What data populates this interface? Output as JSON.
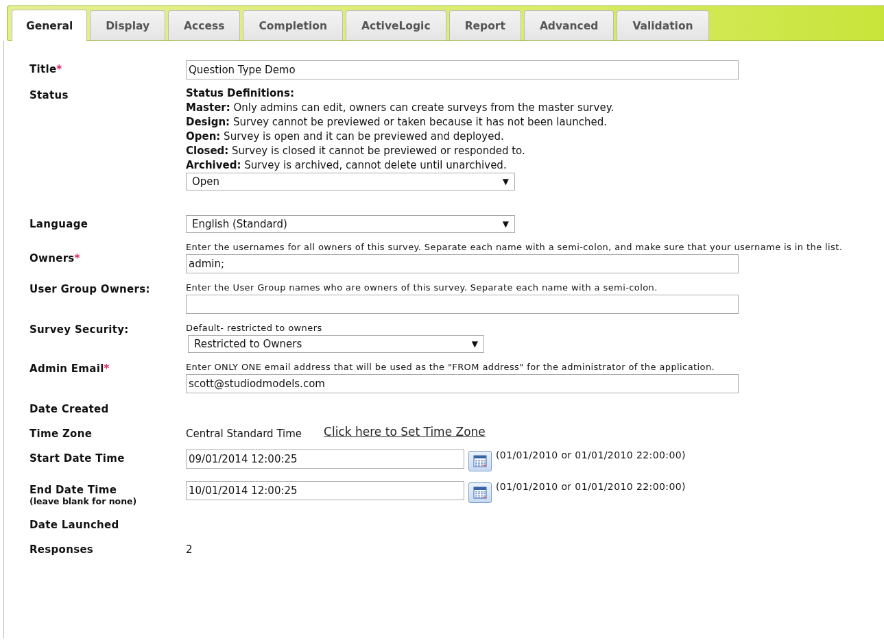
{
  "tabs": [
    {
      "label": "General",
      "selected": true
    },
    {
      "label": "Display",
      "selected": false
    },
    {
      "label": "Access",
      "selected": false
    },
    {
      "label": "Completion",
      "selected": false
    },
    {
      "label": "ActiveLogic",
      "selected": false
    },
    {
      "label": "Report",
      "selected": false
    },
    {
      "label": "Advanced",
      "selected": false
    },
    {
      "label": "Validation",
      "selected": false
    }
  ],
  "fields": [
    {
      "kind": "text",
      "label": "Title",
      "required_mark": "*",
      "value": "Question Type Demo"
    },
    {
      "kind": "status",
      "label": "Status",
      "heading": "Status Definitions:",
      "definitions": [
        "**Master:** Only admins can edit, owners can create surveys from the master survey.",
        "**Design:** Survey cannot be previewed or taken because it has not been launched.",
        "**Open:** Survey is open and it can be previewed and deployed.",
        "**Closed:** Survey is closed it cannot be previewed or responded to.",
        "**Archived:** Survey is archived, cannot delete until unarchived."
      ],
      "value": "Open",
      "arrow": "▼"
    },
    {
      "kind": "select",
      "label": "Language",
      "value": "English (Standard)",
      "arrow": "▼"
    },
    {
      "kind": "text",
      "label": "Owners",
      "required_mark": "*",
      "hint": "Enter the usernames for all owners of this survey. Separate each name with a semi-colon, and make sure that your username is in the list.",
      "value": "admin;"
    },
    {
      "kind": "text",
      "label": "User Group Owners:",
      "hint": "Enter the User Group names who are owners of this survey. Separate each name with a semi-colon."
    },
    {
      "kind": "select",
      "label": "Survey Security:",
      "hint": "Default- restricted to owners",
      "value": "Restricted to Owners",
      "arrow": "▼"
    },
    {
      "kind": "text",
      "label": "Admin Email",
      "required_mark": "*",
      "hint": "Enter ONLY ONE email address that will be used as the \"FROM address\" for the administrator of the application.",
      "value": "scott@studiodmodels.com"
    },
    {
      "kind": "static",
      "label": "Date Created"
    },
    {
      "kind": "static",
      "label": "Time Zone",
      "value": "Central Standard Time",
      "link": "Click here to Set Time Zone"
    },
    {
      "kind": "date",
      "label": "Start Date Time",
      "value": "09/01/2014 12:00:25",
      "format": "(01/01/2010 or 01/01/2010 22:00:00)"
    },
    {
      "kind": "date",
      "label": "End Date Time",
      "sublabel": "(leave blank for none)",
      "value": "10/01/2014 12:00:25",
      "format": "(01/01/2010 or 01/01/2010 22:00:00)"
    },
    {
      "kind": "static",
      "label": "Date Launched"
    },
    {
      "kind": "static",
      "label": "Responses",
      "value": "2"
    }
  ]
}
